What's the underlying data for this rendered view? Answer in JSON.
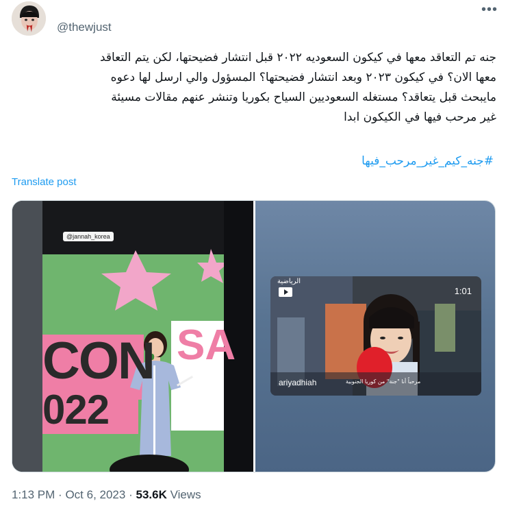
{
  "author": {
    "handle": "@thewjust",
    "avatar_icon": "avatar-photo"
  },
  "tweet": {
    "lines": [
      "جنه تم التعاقد معها في كيكون السعوديه ٢٠٢٢ قبل انتشار فضيحتها، لكن يتم التعاقد",
      "معها الان؟ في كيكون ٢٠٢٣ وبعد انتشار فضيحتها؟ المسؤول والي ارسل لها دعوه",
      "مايبحث قبل يتعاقد؟ مستغله السعوديين السياح بكوريا وتنشر عنهم مقالات مسيئة",
      "غير مرحب فيها في الكيكون ابدا"
    ],
    "hashtag": "#جنه_كيم_غير_مرحب_فيها",
    "translate_label": "Translate post"
  },
  "media": {
    "left": {
      "watermark": "@jannah_korea",
      "banner_letters": "CON",
      "banner_year": "022",
      "banner_side": "SA"
    },
    "right": {
      "duration": "1:01",
      "account": "ariyadhiah",
      "caption": "مرحباً أنا \"جنة\" من كوريا الجنوبية",
      "brand": "الرياضية"
    }
  },
  "footer": {
    "time": "1:13 PM",
    "sep1": "·",
    "date": "Oct 6, 2023",
    "sep2": "·",
    "views_count": "53.6K",
    "views_label": "Views"
  },
  "colors": {
    "link": "#1d9bf0",
    "muted": "#536471",
    "text": "#0f1419"
  }
}
